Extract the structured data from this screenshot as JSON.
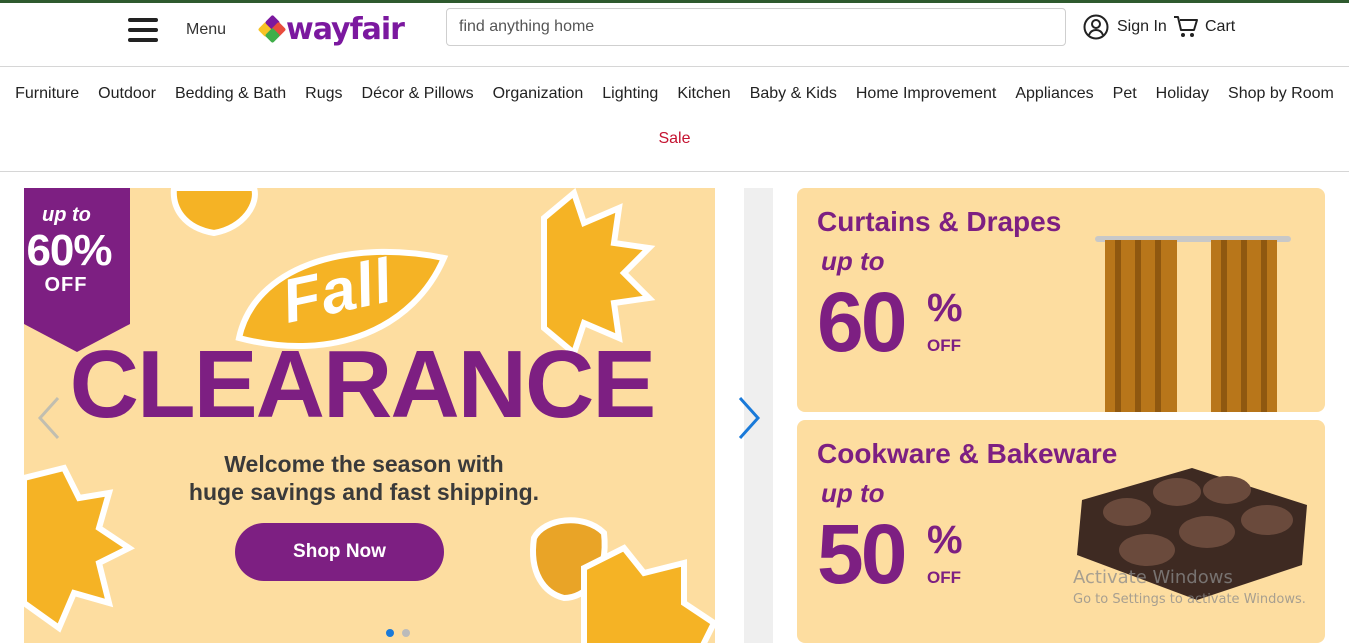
{
  "header": {
    "menu_label": "Menu",
    "logo_text": "wayfair",
    "search_placeholder": "find anything home",
    "sign_in_label": "Sign In",
    "cart_label": "Cart"
  },
  "nav": {
    "categories": [
      "Furniture",
      "Outdoor",
      "Bedding & Bath",
      "Rugs",
      "Décor & Pillows",
      "Organization",
      "Lighting",
      "Kitchen",
      "Baby & Kids",
      "Home Improvement",
      "Appliances",
      "Pet",
      "Holiday",
      "Shop by Room"
    ],
    "sale_label": "Sale"
  },
  "hero": {
    "badge_up_to": "up to",
    "badge_percent": "60%",
    "badge_off": "OFF",
    "fall_word": "Fall",
    "headline": "CLEARANCE",
    "tagline_line1": "Welcome the season with",
    "tagline_line2": "huge savings and fast shipping.",
    "cta_label": "Shop Now",
    "slide_count": 2,
    "active_slide": 1
  },
  "promos": [
    {
      "title": "Curtains & Drapes",
      "up_to": "up to",
      "number": "60",
      "percent": "%",
      "off": "OFF"
    },
    {
      "title": "Cookware & Bakeware",
      "up_to": "up to",
      "number": "50",
      "percent": "%",
      "off": "OFF"
    }
  ],
  "watermark": {
    "line1": "Activate Windows",
    "line2": "Go to Settings to activate Windows."
  },
  "colors": {
    "brand_purple": "#7d1f82",
    "logo_purple": "#7b189f",
    "sale_red": "#c41230",
    "promo_bg": "#fddda0",
    "arrow_blue": "#1a7ad9"
  },
  "icons": [
    "hamburger-icon",
    "wayfair-logo-mark",
    "account-icon",
    "cart-icon",
    "chevron-left-icon",
    "chevron-right-icon"
  ]
}
